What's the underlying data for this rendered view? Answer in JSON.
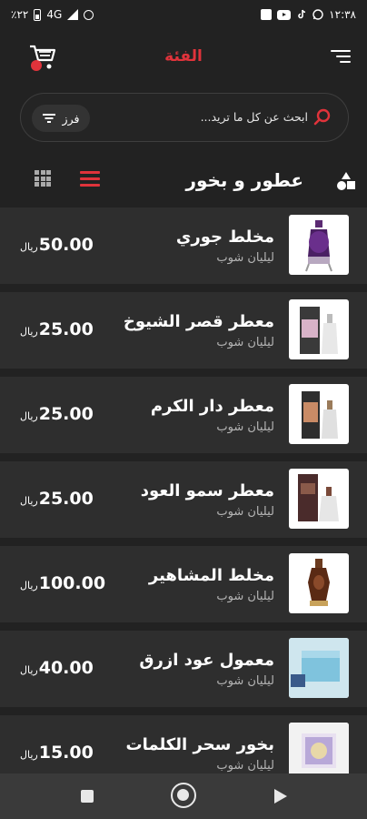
{
  "status_bar": {
    "battery_text": "٪٢٢",
    "network": "4G",
    "time": "١٢:٣٨"
  },
  "app_bar": {
    "title": "الفئة"
  },
  "search": {
    "placeholder": "ابحث عن كل ما تريد...",
    "sort_label": "فرز"
  },
  "category": {
    "title": "عطور و بخور"
  },
  "products": [
    {
      "name": "مخلط جوري",
      "store": "ليليان شوب",
      "price": "50.00",
      "currency": "ريال"
    },
    {
      "name": "معطر قصر الشيوخ",
      "store": "ليليان شوب",
      "price": "25.00",
      "currency": "ريال"
    },
    {
      "name": "معطر دار الكرم",
      "store": "ليليان شوب",
      "price": "25.00",
      "currency": "ريال"
    },
    {
      "name": "معطر سمو العود",
      "store": "ليليان شوب",
      "price": "25.00",
      "currency": "ريال"
    },
    {
      "name": "مخلط المشاهير",
      "store": "ليليان شوب",
      "price": "100.00",
      "currency": "ريال"
    },
    {
      "name": "معمول عود ازرق",
      "store": "ليليان شوب",
      "price": "40.00",
      "currency": "ريال"
    },
    {
      "name": "بخور سحر الكلمات",
      "store": "ليليان شوب",
      "price": "15.00",
      "currency": "ريال"
    }
  ],
  "colors": {
    "accent": "#e0333b",
    "background": "#222222",
    "card": "#2e2e2e"
  }
}
